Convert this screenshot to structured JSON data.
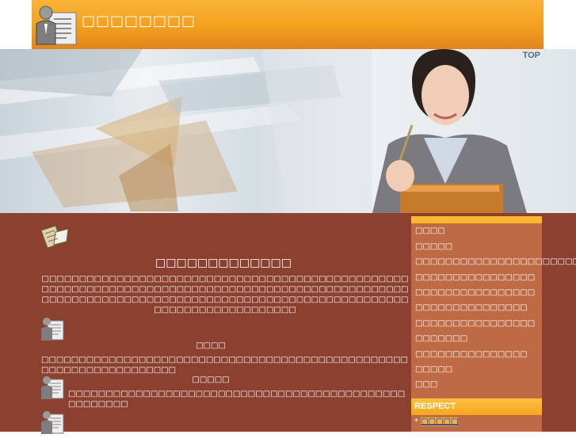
{
  "header": {
    "site_title": "□□□□□□□□",
    "logo_icon": "document-person-logo-icon",
    "top_link": "TOP"
  },
  "hero": {
    "image": "businesswoman-with-notebook-photo"
  },
  "content": {
    "icon": "paperwork-icon",
    "heading": "□□□□□□□□□□□□□",
    "intro": "□□□□□□□□□□□□□□□□□□□□□□□□□□□□□□□□□□□□□□□□□□□□□□□□□□□□□□□□□□□□□□□□□□□□□□□□□□□□□□□□□□□□□□□□□□□□□□□□□□□□□□□□□□□□□□□□□□□□□□□□□□□□□□□□□□□□□□□□□□□□□□□□□□□□□□□□□□□□□□□□□□□□□□",
    "sections": [
      {
        "heading": "□□□□",
        "text": "□□□□□□□□□□□□□□□□□□□□□□□□□□□□□□□□□□□□□□□□□□□□□□□□□□□□□□□□□□□□□□□□□□□"
      },
      {
        "heading": "□□□□□",
        "text": "□□□□□□□□□□□□□□□□□□□□□□□□□□□□□□□□□□□□□□□□□□□□□□□□□□□□□"
      }
    ]
  },
  "sidebar": {
    "menu": [
      "□□□□",
      "□□□□□",
      "□□□□□□□□□□□□□□□□□□□□□□□□□",
      "□□□□□□□□□□□□□□□□",
      "□□□□□□□□□□□□□□□□",
      "□□□□□□□□□□□□□□□",
      "□□□□□□□□□□□□□□□□",
      "□□□□□□□",
      "□□□□□□□□□□□□□□□",
      "□□□□□",
      "□□□"
    ],
    "respect_label": "RESPECT",
    "respect_link": "□□□□□"
  },
  "colors": {
    "header_orange": "#f3a21f",
    "main_brown": "#8b4030",
    "sidebar_brown": "#be6a45",
    "accent_yellow": "#fbb72d"
  }
}
